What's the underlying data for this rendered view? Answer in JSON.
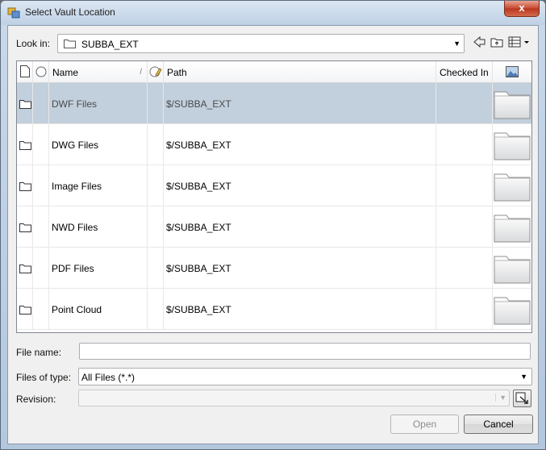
{
  "window": {
    "title": "Select Vault Location",
    "close_glyph": "x"
  },
  "lookin": {
    "label": "Look in:",
    "value": "SUBBA_EXT"
  },
  "toolbar": {
    "icons": [
      "back-arrow-icon",
      "up-folder-icon",
      "view-menu-icon"
    ]
  },
  "columns": {
    "name": "Name",
    "name_sort_glyph": "/",
    "path": "Path",
    "checked_in": "Checked In"
  },
  "rows": [
    {
      "name": "DWF Files",
      "path": "$/SUBBA_EXT",
      "checked_in": "",
      "selected": true
    },
    {
      "name": "DWG Files",
      "path": "$/SUBBA_EXT",
      "checked_in": "",
      "selected": false
    },
    {
      "name": "Image Files",
      "path": "$/SUBBA_EXT",
      "checked_in": "",
      "selected": false
    },
    {
      "name": "NWD Files",
      "path": "$/SUBBA_EXT",
      "checked_in": "",
      "selected": false
    },
    {
      "name": "PDF Files",
      "path": "$/SUBBA_EXT",
      "checked_in": "",
      "selected": false
    },
    {
      "name": "Point Cloud",
      "path": "$/SUBBA_EXT",
      "checked_in": "",
      "selected": false
    }
  ],
  "form": {
    "filename_label": "File name:",
    "filename_value": "",
    "filetype_label": "Files of type:",
    "filetype_value": "All Files (*.*)",
    "revision_label": "Revision:",
    "revision_value": ""
  },
  "buttons": {
    "open": "Open",
    "cancel": "Cancel"
  },
  "colors": {
    "selection": "#c2cfdc",
    "title_gradient_top": "#dbe6f2",
    "close_red": "#c7482f"
  }
}
